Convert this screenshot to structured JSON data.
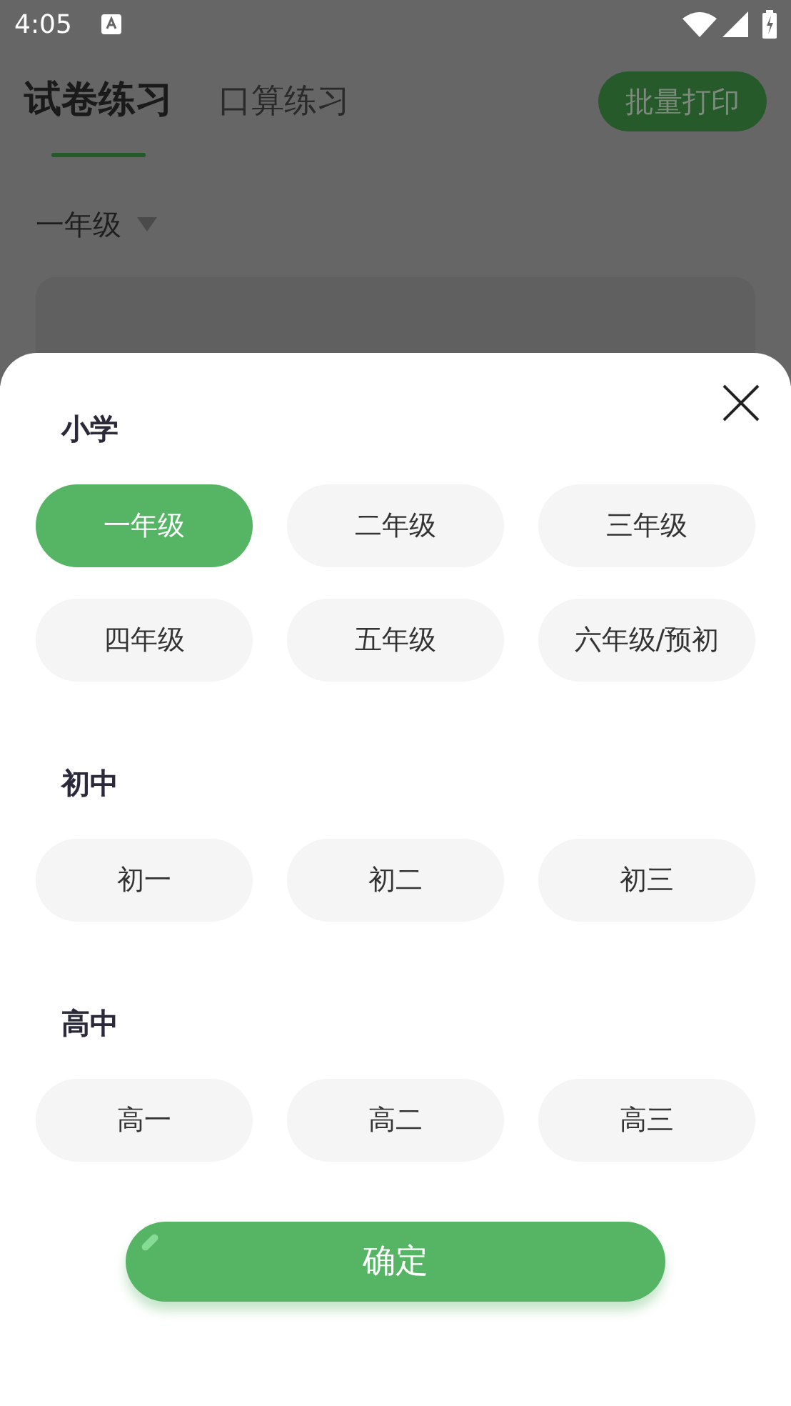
{
  "status_bar": {
    "time": "4:05"
  },
  "tabs": [
    {
      "label": "试卷练习",
      "selected": true
    },
    {
      "label": "口算练习",
      "selected": false
    }
  ],
  "print_button": "批量打印",
  "grade_selector": "一年级",
  "sheet": {
    "sections": [
      {
        "title": "小学",
        "items": [
          {
            "label": "一年级",
            "selected": true
          },
          {
            "label": "二年级",
            "selected": false
          },
          {
            "label": "三年级",
            "selected": false
          },
          {
            "label": "四年级",
            "selected": false
          },
          {
            "label": "五年级",
            "selected": false
          },
          {
            "label": "六年级/预初",
            "selected": false
          }
        ]
      },
      {
        "title": "初中",
        "items": [
          {
            "label": "初一",
            "selected": false
          },
          {
            "label": "初二",
            "selected": false
          },
          {
            "label": "初三",
            "selected": false
          }
        ]
      },
      {
        "title": "高中",
        "items": [
          {
            "label": "高一",
            "selected": false
          },
          {
            "label": "高二",
            "selected": false
          },
          {
            "label": "高三",
            "selected": false
          }
        ]
      }
    ],
    "confirm": "确定"
  }
}
